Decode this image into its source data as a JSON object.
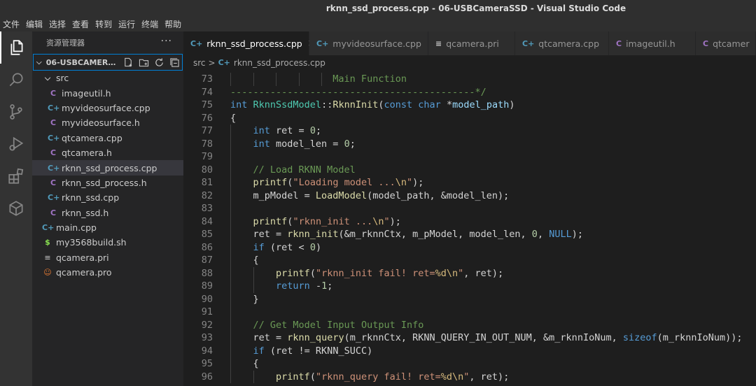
{
  "window": {
    "title": "rknn_ssd_process.cpp - 06-USBCameraSSD - Visual Studio Code"
  },
  "menu": [
    "文件",
    "编辑",
    "选择",
    "查看",
    "转到",
    "运行",
    "终端",
    "帮助"
  ],
  "activity_bar": [
    {
      "icon": "explorer-icon",
      "active": true
    },
    {
      "icon": "search-icon"
    },
    {
      "icon": "source-control-icon"
    },
    {
      "icon": "run-debug-icon"
    },
    {
      "icon": "extensions-icon"
    },
    {
      "icon": "remote-explorer-icon"
    }
  ],
  "explorer": {
    "header": "资源管理器",
    "more": "···",
    "folder": "06-USBCAMERAS...",
    "folder_actions": [
      "new-file-icon",
      "new-folder-icon",
      "refresh-icon",
      "collapse-all-icon"
    ],
    "tree": [
      {
        "label": "src",
        "icon": "chevron-down",
        "depth": 1,
        "type": "folder"
      },
      {
        "label": "imageutil.h",
        "icon": "C",
        "depth": 2,
        "type": "c"
      },
      {
        "label": "myvideosurface.cpp",
        "icon": "C+",
        "depth": 2,
        "type": "cpp"
      },
      {
        "label": "myvideosurface.h",
        "icon": "C",
        "depth": 2,
        "type": "c"
      },
      {
        "label": "qtcamera.cpp",
        "icon": "C+",
        "depth": 2,
        "type": "cpp"
      },
      {
        "label": "qtcamera.h",
        "icon": "C",
        "depth": 2,
        "type": "c"
      },
      {
        "label": "rknn_ssd_process.cpp",
        "icon": "C+",
        "depth": 2,
        "type": "cpp",
        "selected": true
      },
      {
        "label": "rknn_ssd_process.h",
        "icon": "C",
        "depth": 2,
        "type": "c"
      },
      {
        "label": "rknn_ssd.cpp",
        "icon": "C+",
        "depth": 2,
        "type": "cpp"
      },
      {
        "label": "rknn_ssd.h",
        "icon": "C",
        "depth": 2,
        "type": "c"
      },
      {
        "label": "main.cpp",
        "icon": "C+",
        "depth": 1,
        "type": "cpp"
      },
      {
        "label": "my3568build.sh",
        "icon": "$",
        "depth": 1,
        "type": "sh"
      },
      {
        "label": "qcamera.pri",
        "icon": "≡",
        "depth": 1,
        "type": "pri"
      },
      {
        "label": "qcamera.pro",
        "icon": "☺",
        "depth": 1,
        "type": "pro"
      }
    ]
  },
  "tabs": [
    {
      "label": "rknn_ssd_process.cpp",
      "icon": "C+",
      "type": "cpp",
      "active": true,
      "close": "×"
    },
    {
      "label": "myvideosurface.cpp",
      "icon": "C+",
      "type": "cpp"
    },
    {
      "label": "qcamera.pri",
      "icon": "≡",
      "type": "pri"
    },
    {
      "label": "qtcamera.cpp",
      "icon": "C+",
      "type": "cpp"
    },
    {
      "label": "imageutil.h",
      "icon": "C",
      "type": "c"
    },
    {
      "label": "qtcamer",
      "icon": "C",
      "type": "c"
    }
  ],
  "breadcrumb": {
    "folder": "src",
    "separator": ">",
    "file": "rknn_ssd_process.cpp",
    "file_icon": "C+"
  },
  "editor": {
    "lines": [
      {
        "num": "73",
        "indent": 0,
        "guides": [
          0,
          4,
          8,
          12,
          16
        ],
        "tokens": [
          [
            "com",
            "                  Main Function"
          ]
        ]
      },
      {
        "num": "74",
        "indent": 0,
        "guides": [],
        "tokens": [
          [
            "com",
            "-------------------------------------------*/"
          ]
        ]
      },
      {
        "num": "75",
        "indent": 0,
        "guides": [],
        "tokens": [
          [
            "kw",
            "int"
          ],
          [
            "plain",
            " "
          ],
          [
            "type",
            "RknnSsdModel"
          ],
          [
            "plain",
            "::"
          ],
          [
            "fn",
            "RknnInit"
          ],
          [
            "plain",
            "("
          ],
          [
            "kw",
            "const"
          ],
          [
            "plain",
            " "
          ],
          [
            "kw",
            "char"
          ],
          [
            "plain",
            " *"
          ],
          [
            "var",
            "model_path"
          ],
          [
            "plain",
            ")"
          ]
        ]
      },
      {
        "num": "76",
        "indent": 0,
        "guides": [],
        "tokens": [
          [
            "plain",
            "{"
          ]
        ]
      },
      {
        "num": "77",
        "indent": 4,
        "guides": [
          0
        ],
        "tokens": [
          [
            "kw",
            "int"
          ],
          [
            "plain",
            " ret = "
          ],
          [
            "num",
            "0"
          ],
          [
            "plain",
            ";"
          ]
        ]
      },
      {
        "num": "78",
        "indent": 4,
        "guides": [
          0
        ],
        "tokens": [
          [
            "kw",
            "int"
          ],
          [
            "plain",
            " model_len = "
          ],
          [
            "num",
            "0"
          ],
          [
            "plain",
            ";"
          ]
        ]
      },
      {
        "num": "79",
        "indent": 4,
        "guides": [
          0
        ],
        "tokens": []
      },
      {
        "num": "80",
        "indent": 4,
        "guides": [
          0
        ],
        "tokens": [
          [
            "com",
            "// Load RKNN Model"
          ]
        ]
      },
      {
        "num": "81",
        "indent": 4,
        "guides": [
          0
        ],
        "tokens": [
          [
            "fn",
            "printf"
          ],
          [
            "plain",
            "("
          ],
          [
            "str",
            "\"Loading model ..."
          ],
          [
            "esc",
            "\\n"
          ],
          [
            "str",
            "\""
          ],
          [
            "plain",
            ");"
          ]
        ]
      },
      {
        "num": "82",
        "indent": 4,
        "guides": [
          0
        ],
        "tokens": [
          [
            "plain",
            "m_pModel = "
          ],
          [
            "fn",
            "LoadModel"
          ],
          [
            "plain",
            "(model_path, &model_len);"
          ]
        ]
      },
      {
        "num": "83",
        "indent": 4,
        "guides": [
          0
        ],
        "tokens": []
      },
      {
        "num": "84",
        "indent": 4,
        "guides": [
          0
        ],
        "tokens": [
          [
            "fn",
            "printf"
          ],
          [
            "plain",
            "("
          ],
          [
            "str",
            "\"rknn_init ..."
          ],
          [
            "esc",
            "\\n"
          ],
          [
            "str",
            "\""
          ],
          [
            "plain",
            ");"
          ]
        ]
      },
      {
        "num": "85",
        "indent": 4,
        "guides": [
          0
        ],
        "tokens": [
          [
            "plain",
            "ret = "
          ],
          [
            "fn",
            "rknn_init"
          ],
          [
            "plain",
            "(&m_rknnCtx, m_pModel, model_len, "
          ],
          [
            "num",
            "0"
          ],
          [
            "plain",
            ", "
          ],
          [
            "macro",
            "NULL"
          ],
          [
            "plain",
            ");"
          ]
        ]
      },
      {
        "num": "86",
        "indent": 4,
        "guides": [
          0
        ],
        "tokens": [
          [
            "kw",
            "if"
          ],
          [
            "plain",
            " (ret < "
          ],
          [
            "num",
            "0"
          ],
          [
            "plain",
            ")"
          ]
        ]
      },
      {
        "num": "87",
        "indent": 4,
        "guides": [
          0
        ],
        "tokens": [
          [
            "plain",
            "{"
          ]
        ]
      },
      {
        "num": "88",
        "indent": 8,
        "guides": [
          0,
          4
        ],
        "tokens": [
          [
            "fn",
            "printf"
          ],
          [
            "plain",
            "("
          ],
          [
            "str",
            "\"rknn_init fail! ret="
          ],
          [
            "esc",
            "%d\\n"
          ],
          [
            "str",
            "\""
          ],
          [
            "plain",
            ", ret);"
          ]
        ]
      },
      {
        "num": "89",
        "indent": 8,
        "guides": [
          0,
          4
        ],
        "tokens": [
          [
            "kw",
            "return"
          ],
          [
            "plain",
            " -"
          ],
          [
            "num",
            "1"
          ],
          [
            "plain",
            ";"
          ]
        ]
      },
      {
        "num": "90",
        "indent": 4,
        "guides": [
          0
        ],
        "tokens": [
          [
            "plain",
            "}"
          ]
        ]
      },
      {
        "num": "91",
        "indent": 4,
        "guides": [
          0
        ],
        "tokens": []
      },
      {
        "num": "92",
        "indent": 4,
        "guides": [
          0
        ],
        "tokens": [
          [
            "com",
            "// Get Model Input Output Info"
          ]
        ]
      },
      {
        "num": "93",
        "indent": 4,
        "guides": [
          0
        ],
        "tokens": [
          [
            "plain",
            "ret = "
          ],
          [
            "fn",
            "rknn_query"
          ],
          [
            "plain",
            "(m_rknnCtx, RKNN_QUERY_IN_OUT_NUM, &m_rknnIoNum, "
          ],
          [
            "kw",
            "sizeof"
          ],
          [
            "plain",
            "(m_rknnIoNum));"
          ]
        ]
      },
      {
        "num": "94",
        "indent": 4,
        "guides": [
          0
        ],
        "tokens": [
          [
            "kw",
            "if"
          ],
          [
            "plain",
            " (ret != RKNN_SUCC)"
          ]
        ]
      },
      {
        "num": "95",
        "indent": 4,
        "guides": [
          0
        ],
        "tokens": [
          [
            "plain",
            "{"
          ]
        ]
      },
      {
        "num": "96",
        "indent": 8,
        "guides": [
          0,
          4
        ],
        "tokens": [
          [
            "fn",
            "printf"
          ],
          [
            "plain",
            "("
          ],
          [
            "str",
            "\"rknn_query fail! ret="
          ],
          [
            "esc",
            "%d\\n"
          ],
          [
            "str",
            "\""
          ],
          [
            "plain",
            ", ret);"
          ]
        ]
      }
    ]
  }
}
